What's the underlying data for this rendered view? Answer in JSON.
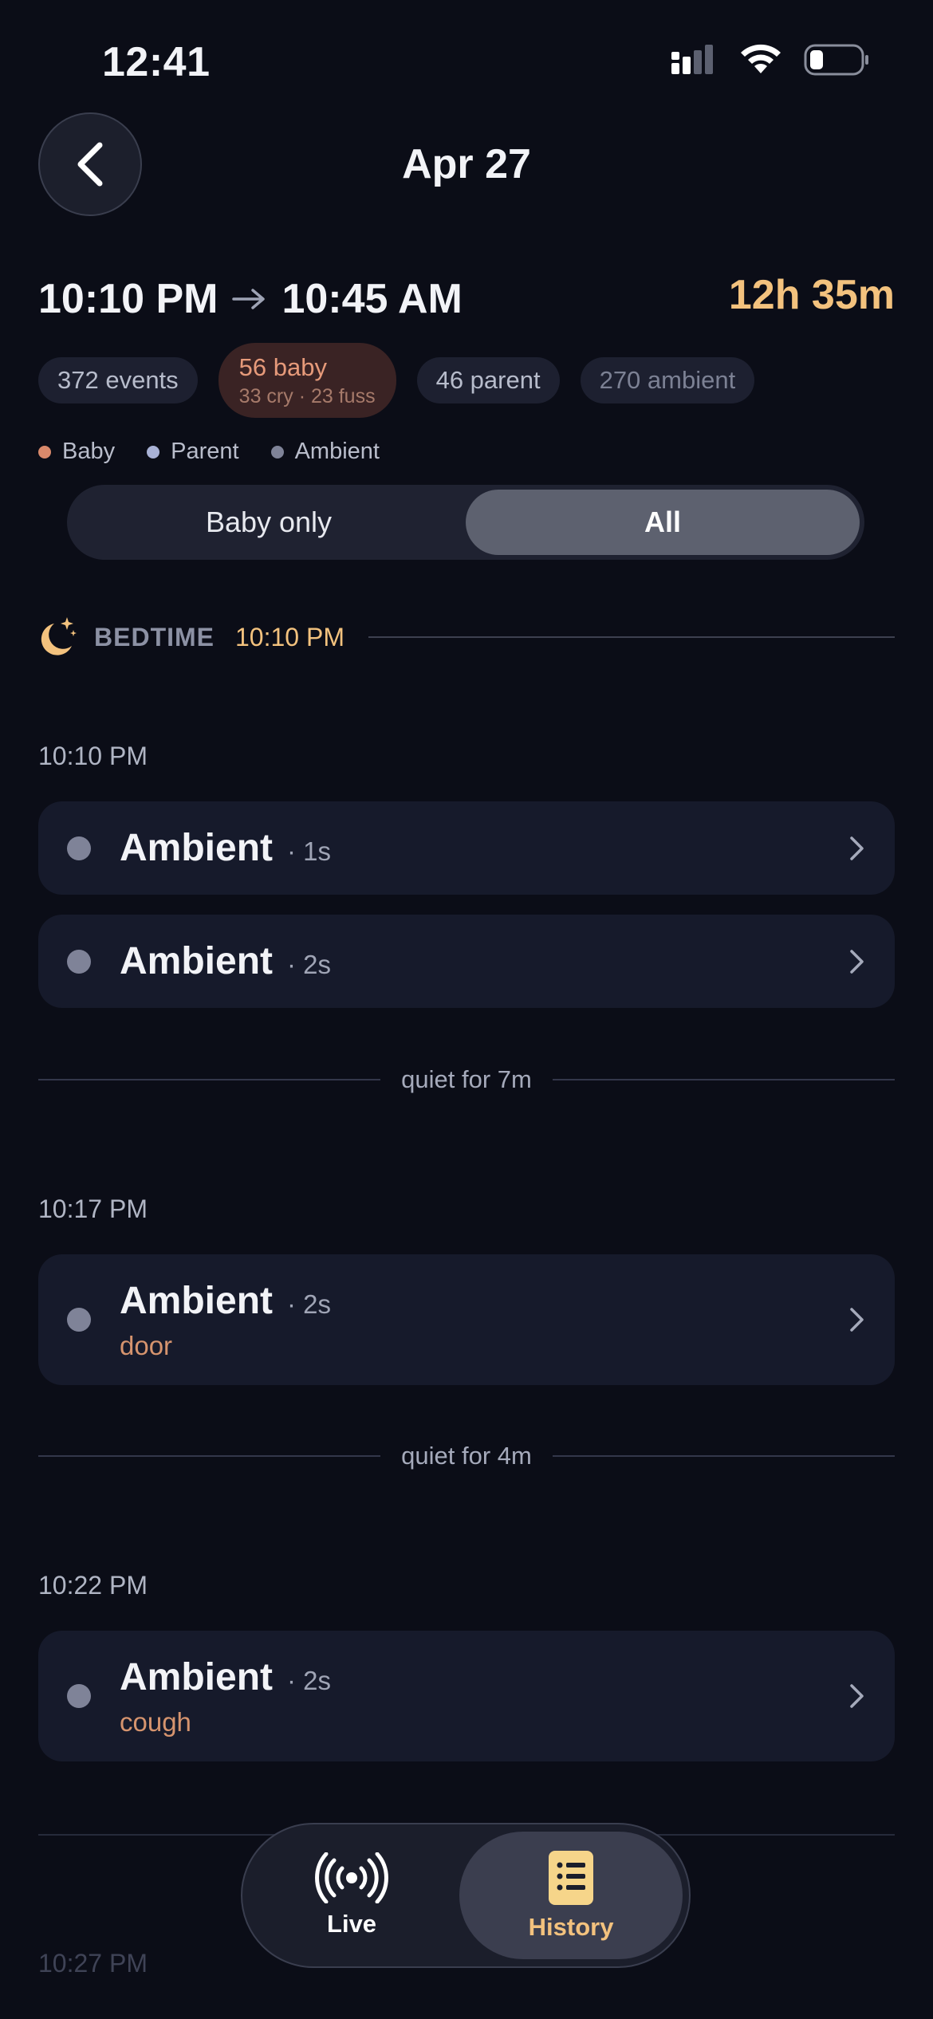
{
  "status_bar": {
    "time": "12:41"
  },
  "header": {
    "title": "Apr 27"
  },
  "summary": {
    "start_time": "10:10 PM",
    "end_time": "10:45 AM",
    "duration": "12h 35m",
    "events_chip": "372 events",
    "baby_chip": "56 baby",
    "baby_breakdown": "33 cry · 23 fuss",
    "parent_chip": "46 parent",
    "ambient_chip": "270 ambient"
  },
  "legend": {
    "baby": "Baby",
    "parent": "Parent",
    "ambient": "Ambient",
    "colors": {
      "baby": "#d9896b",
      "parent": "#a9b2d6",
      "ambient": "#7f8398"
    }
  },
  "filter": {
    "baby_only": "Baby only",
    "all": "All",
    "selected": "All"
  },
  "bedtime": {
    "label": "BEDTIME",
    "time": "10:10 PM",
    "icon": "moon-stars-icon"
  },
  "timeline": {
    "group1": {
      "time": "10:10 PM",
      "events": [
        {
          "title": "Ambient",
          "duration": "· 1s"
        },
        {
          "title": "Ambient",
          "duration": "· 2s"
        }
      ]
    },
    "quiet1": "quiet for 7m",
    "group2": {
      "time": "10:17 PM",
      "events": [
        {
          "title": "Ambient",
          "duration": "· 2s",
          "tag": "door"
        }
      ]
    },
    "quiet2": "quiet for 4m",
    "group3": {
      "time": "10:22 PM",
      "events": [
        {
          "title": "Ambient",
          "duration": "· 2s",
          "tag": "cough"
        }
      ]
    },
    "group4": {
      "time": "10:27 PM"
    }
  },
  "tabbar": {
    "live": {
      "label": "Live",
      "icon": "broadcast-icon"
    },
    "history": {
      "label": "History",
      "icon": "notebook-list-icon",
      "active": true
    }
  }
}
